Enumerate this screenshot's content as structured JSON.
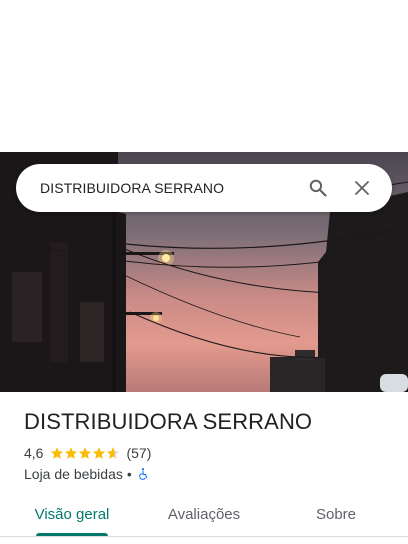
{
  "search": {
    "query": "DISTRIBUIDORA SERRANO"
  },
  "place": {
    "name": "DISTRIBUIDORA SERRANO",
    "rating": "4,6",
    "rating_value": 4.6,
    "review_count": "(57)",
    "category": "Loja de bebidas",
    "separator": "•"
  },
  "tabs": [
    {
      "label": "Visão geral",
      "active": true
    },
    {
      "label": "Avaliações",
      "active": false
    },
    {
      "label": "Sobre",
      "active": false
    }
  ],
  "colors": {
    "accent": "#00796b",
    "star": "#fbbc04",
    "accessibility": "#1a73e8"
  },
  "icons": [
    "search-icon",
    "close-icon",
    "star-icon",
    "wheelchair-icon"
  ]
}
